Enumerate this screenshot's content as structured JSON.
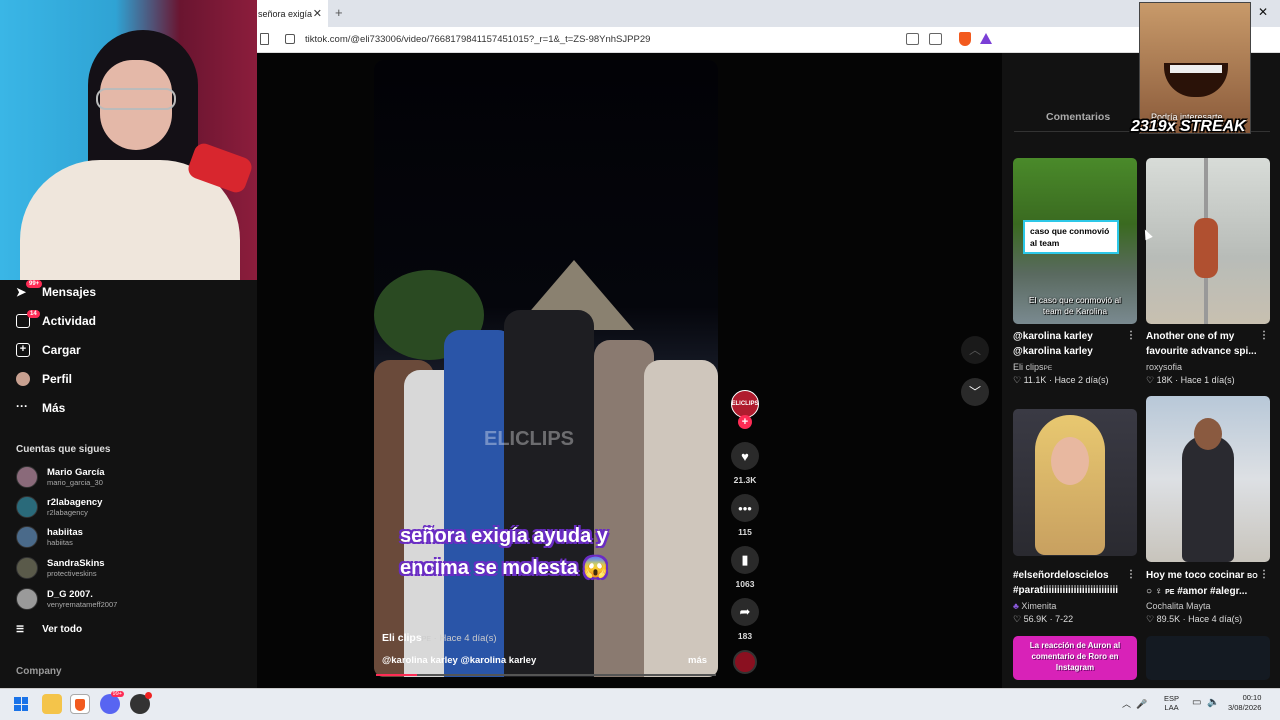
{
  "browser": {
    "tab_title": "señora exigía",
    "tab_close": "✕",
    "new_tab": "+",
    "window_close": "✕",
    "url": "tiktok.com/@eli733006/video/7668179841157451015?_r=1&_t=ZS-98YnhSJPP29"
  },
  "sidebar": {
    "items": [
      {
        "label": "Mensajes",
        "badge": "99+",
        "icon": "paper-plane-icon"
      },
      {
        "label": "Actividad",
        "badge": "14",
        "icon": "inbox-icon"
      },
      {
        "label": "Cargar",
        "icon": "plus-square-icon"
      },
      {
        "label": "Perfil",
        "icon": "avatar-icon"
      },
      {
        "label": "Más",
        "icon": "more-dots-icon"
      }
    ],
    "following_title": "Cuentas que sigues",
    "following": [
      {
        "name": "Mario García",
        "handle": "mario_garcia_30"
      },
      {
        "name": "r2labagency",
        "handle": "r2labagency"
      },
      {
        "name": "habiitas",
        "handle": "habiitas"
      },
      {
        "name": "SandraSkins",
        "handle": "protectiveskins"
      },
      {
        "name": "D_G 2007.",
        "handle": "venyrematameff2007"
      }
    ],
    "see_all": "Ver todo",
    "company": "Company"
  },
  "video": {
    "caption_line1": "señora exigía ayuda y",
    "caption_line2": "encima se molesta 😱",
    "watermark": "ELICLIPS",
    "author": "Eli clips",
    "author_flag": "PE",
    "time": " · Hace 4 día(s)",
    "description": "@karolina karley @karolina karley",
    "more": "más",
    "progress": 0.12
  },
  "actions": {
    "likes": "21.3K",
    "comments": "115",
    "saves": "1063",
    "shares": "183",
    "avatar_text": "ELICLIPS",
    "plus": "+"
  },
  "right_panel": {
    "tab_comments": "Comentarios",
    "tab_related": "Podría interesarte",
    "streak": "2319x STREAK",
    "cards": [
      {
        "title1": "@karolina karley",
        "title2": "@karolina karley",
        "author": "Eli clips",
        "flag": "PE",
        "likes": "11.1K",
        "time": "Hace 2 día(s)",
        "overlay_box": "caso que conmovió al team",
        "overlay_text": "El caso que conmovió al team de Karolina"
      },
      {
        "title1": "Another one of my",
        "title2": "favourite advance spi...",
        "author": "roxysofia",
        "flag": "",
        "likes": "18K",
        "time": "Hace 1 día(s)"
      },
      {
        "title1": "#elseñordeloscielos",
        "title2": "#paratiiiiiiiiiiiiiiiiiiiiiiiiiii",
        "author": "Ximenita",
        "flag": "",
        "likes": "56.9K",
        "time": "7-22"
      },
      {
        "title1": "Hoy me toco cocinar",
        "title1_flag": "BO",
        "title2": "#amor #alegr...",
        "title2_flag": "PE",
        "author": "Cochalita Mayta",
        "flag": "",
        "likes": "89.5K",
        "time": "Hace 4 día(s)"
      },
      {
        "overlay_text": "La reacción de Auron al comentario de Roro en Instagram"
      }
    ]
  },
  "taskbar": {
    "lang1": "ESP",
    "lang2": "LAA",
    "time": "00:10",
    "date": "3/08/2026",
    "discord_badge": "99+"
  },
  "colors": {
    "accent": "#fe2c55",
    "background": "#121212",
    "caption_outline": "#6a2cc4"
  }
}
